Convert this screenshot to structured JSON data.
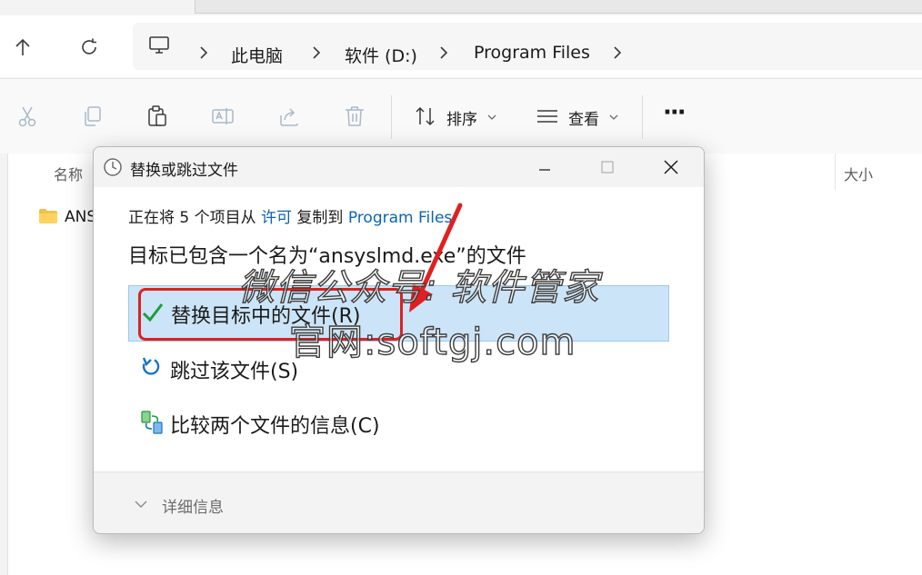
{
  "nav": {
    "breadcrumb": [
      "此电脑",
      "软件 (D:)",
      "Program Files"
    ]
  },
  "toolbar": {
    "sort_label": "排序",
    "view_label": "查看",
    "more_label": "···"
  },
  "list": {
    "col_name": "名称",
    "col_size": "大小",
    "rows": [
      {
        "name": "ANS"
      }
    ]
  },
  "dialog": {
    "title": "替换或跳过文件",
    "line1_prefix": "正在将 5 个项目从 ",
    "line1_source": "许可",
    "line1_middle": " 复制到 ",
    "line1_dest": "Program Files",
    "heading": "目标已包含一个名为“ansyslmd.exe”的文件",
    "options": [
      {
        "label": "替换目标中的文件(R)",
        "icon": "checkmark-icon",
        "selected": true
      },
      {
        "label": "跳过该文件(S)",
        "icon": "skip-arrow-icon",
        "selected": false
      },
      {
        "label": "比较两个文件的信息(C)",
        "icon": "compare-icon",
        "selected": false
      }
    ],
    "details_label": "详细信息"
  },
  "watermark": {
    "line1": "微信公众号: 软件管家",
    "line2": "官网:softgj.com"
  },
  "colors": {
    "accent": "#0a64b4",
    "selection": "#cce4f7",
    "annotation": "#e02020",
    "check": "#1f9c3a"
  }
}
